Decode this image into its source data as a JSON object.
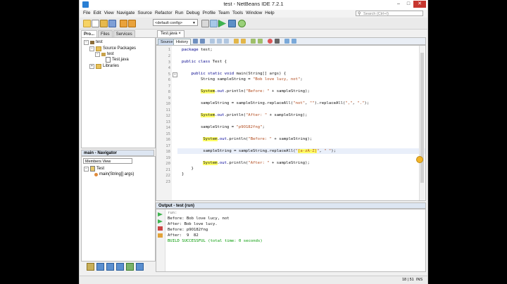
{
  "window": {
    "title": "test - NetBeans IDE 7.2.1",
    "buttons": [
      "–",
      "□",
      "✕"
    ]
  },
  "menu": [
    "File",
    "Edit",
    "View",
    "Navigate",
    "Source",
    "Refactor",
    "Run",
    "Debug",
    "Profile",
    "Team",
    "Tools",
    "Window",
    "Help"
  ],
  "search": {
    "placeholder": "Search (Ctrl+I)"
  },
  "toolbar": {
    "config": "<default config>"
  },
  "left_tabs": [
    "Pro...",
    "Files",
    "Services"
  ],
  "project_tree": {
    "root": "test",
    "source_packages": "Source Packages",
    "package": "test",
    "file": "Test.java",
    "libraries": "Libraries"
  },
  "navigator": {
    "title": "main - Navigator",
    "members_view": "Members View",
    "class": "Test",
    "method": "main(String[] args)"
  },
  "editor": {
    "tab": "Test.java",
    "source_label": "Source",
    "history_label": "History",
    "line_numbers": [
      "1",
      "2",
      "3",
      "4",
      "5",
      "6",
      "7",
      "8",
      "9",
      "10",
      "11",
      "12",
      "13",
      "14",
      "15",
      "16",
      "17",
      "18",
      "19",
      "20",
      "21",
      "22",
      "23"
    ],
    "current_line": "18"
  },
  "output": {
    "title": "Output - test (run)",
    "lines": [
      "run:",
      "Before: Bob love lucy, not",
      "After: Bob love lucy.",
      "Before: p9O182fng",
      "After:  9  82",
      "BUILD SUCCESSFUL (total time: 0 seconds)"
    ]
  },
  "status": {
    "position": "18 | 51",
    "mode": "INS"
  },
  "colors": {
    "keyword": "#00008b",
    "string": "#b0481a",
    "highlight": "#ffff66",
    "success": "#009900"
  }
}
